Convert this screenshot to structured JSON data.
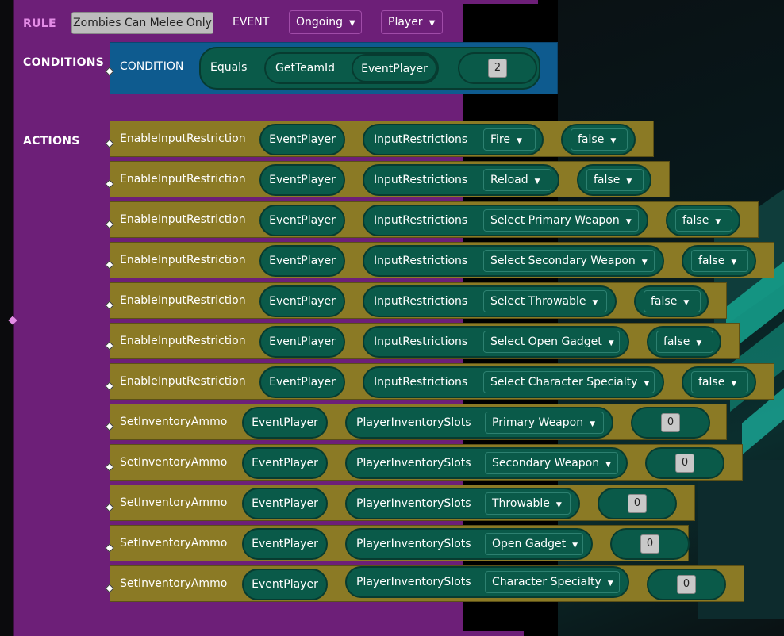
{
  "rule": {
    "label": "RULE",
    "name": "Zombies Can Melee Only",
    "event_label": "EVENT",
    "event_value": "Ongoing",
    "event_target": "Player"
  },
  "conditions": {
    "label": "CONDITIONS",
    "block_label": "CONDITION",
    "operator": "Equals",
    "function": "GetTeamId",
    "argument": "EventPlayer",
    "value": "2"
  },
  "actions": {
    "label": "ACTIONS",
    "rows": [
      {
        "name": "EnableInputRestriction",
        "player": "EventPlayer",
        "param": "InputRestrictions",
        "option": "Fire",
        "value": "false"
      },
      {
        "name": "EnableInputRestriction",
        "player": "EventPlayer",
        "param": "InputRestrictions",
        "option": "Reload",
        "value": "false"
      },
      {
        "name": "EnableInputRestriction",
        "player": "EventPlayer",
        "param": "InputRestrictions",
        "option": "Select Primary Weapon",
        "value": "false"
      },
      {
        "name": "EnableInputRestriction",
        "player": "EventPlayer",
        "param": "InputRestrictions",
        "option": "Select Secondary Weapon",
        "value": "false"
      },
      {
        "name": "EnableInputRestriction",
        "player": "EventPlayer",
        "param": "InputRestrictions",
        "option": "Select Throwable",
        "value": "false"
      },
      {
        "name": "EnableInputRestriction",
        "player": "EventPlayer",
        "param": "InputRestrictions",
        "option": "Select Open Gadget",
        "value": "false"
      },
      {
        "name": "EnableInputRestriction",
        "player": "EventPlayer",
        "param": "InputRestrictions",
        "option": "Select Character Specialty",
        "value": "false"
      },
      {
        "name": "SetInventoryAmmo",
        "player": "EventPlayer",
        "param": "PlayerInventorySlots",
        "option": "Primary Weapon",
        "value": "0"
      },
      {
        "name": "SetInventoryAmmo",
        "player": "EventPlayer",
        "param": "PlayerInventorySlots",
        "option": "Secondary Weapon",
        "value": "0"
      },
      {
        "name": "SetInventoryAmmo",
        "player": "EventPlayer",
        "param": "PlayerInventorySlots",
        "option": "Throwable",
        "value": "0"
      },
      {
        "name": "SetInventoryAmmo",
        "player": "EventPlayer",
        "param": "PlayerInventorySlots",
        "option": "Open Gadget",
        "value": "0"
      },
      {
        "name": "SetInventoryAmmo",
        "player": "EventPlayer",
        "param": "PlayerInventorySlots",
        "option": "Character Specialty",
        "value": "0"
      }
    ]
  },
  "colors": {
    "rule_purple": "#6d1f78",
    "condition_blue": "#0e5b8f",
    "action_olive": "#8b7a25",
    "pill_green": "#0a5a49",
    "rule_label_pink": "#e38ce6"
  }
}
